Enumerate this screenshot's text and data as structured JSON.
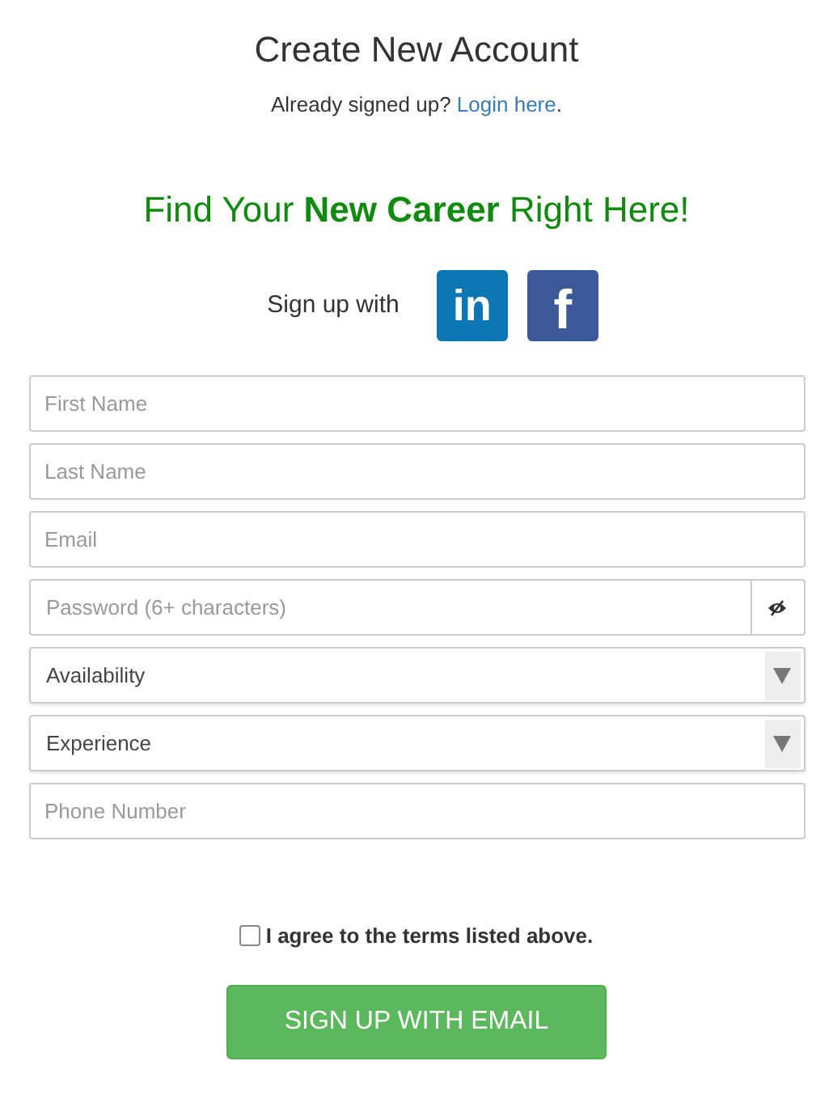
{
  "title": "Create New Account",
  "login_prompt": {
    "text": "Already signed up?",
    "link": "Login here",
    "after": "."
  },
  "headline": "Find Your **New Career** Right Here!",
  "social": {
    "label": "Sign up with",
    "buttons": [
      {
        "kind": "linkedin",
        "glyph": "in"
      },
      {
        "kind": "facebook",
        "glyph": "f"
      }
    ]
  },
  "fields": [
    {
      "kind": "text",
      "placeholder": "First Name"
    },
    {
      "kind": "text",
      "placeholder": "Last Name"
    },
    {
      "kind": "text",
      "placeholder": "Email"
    },
    {
      "kind": "password",
      "placeholder": "Password (6+ characters)"
    },
    {
      "kind": "select",
      "value": "Availability"
    },
    {
      "kind": "select",
      "value": "Experience"
    },
    {
      "kind": "text",
      "placeholder": "Phone Number"
    }
  ],
  "terms": {
    "label": "I agree to the terms listed above.",
    "checked": false
  },
  "submit": "SIGN UP WITH EMAIL"
}
